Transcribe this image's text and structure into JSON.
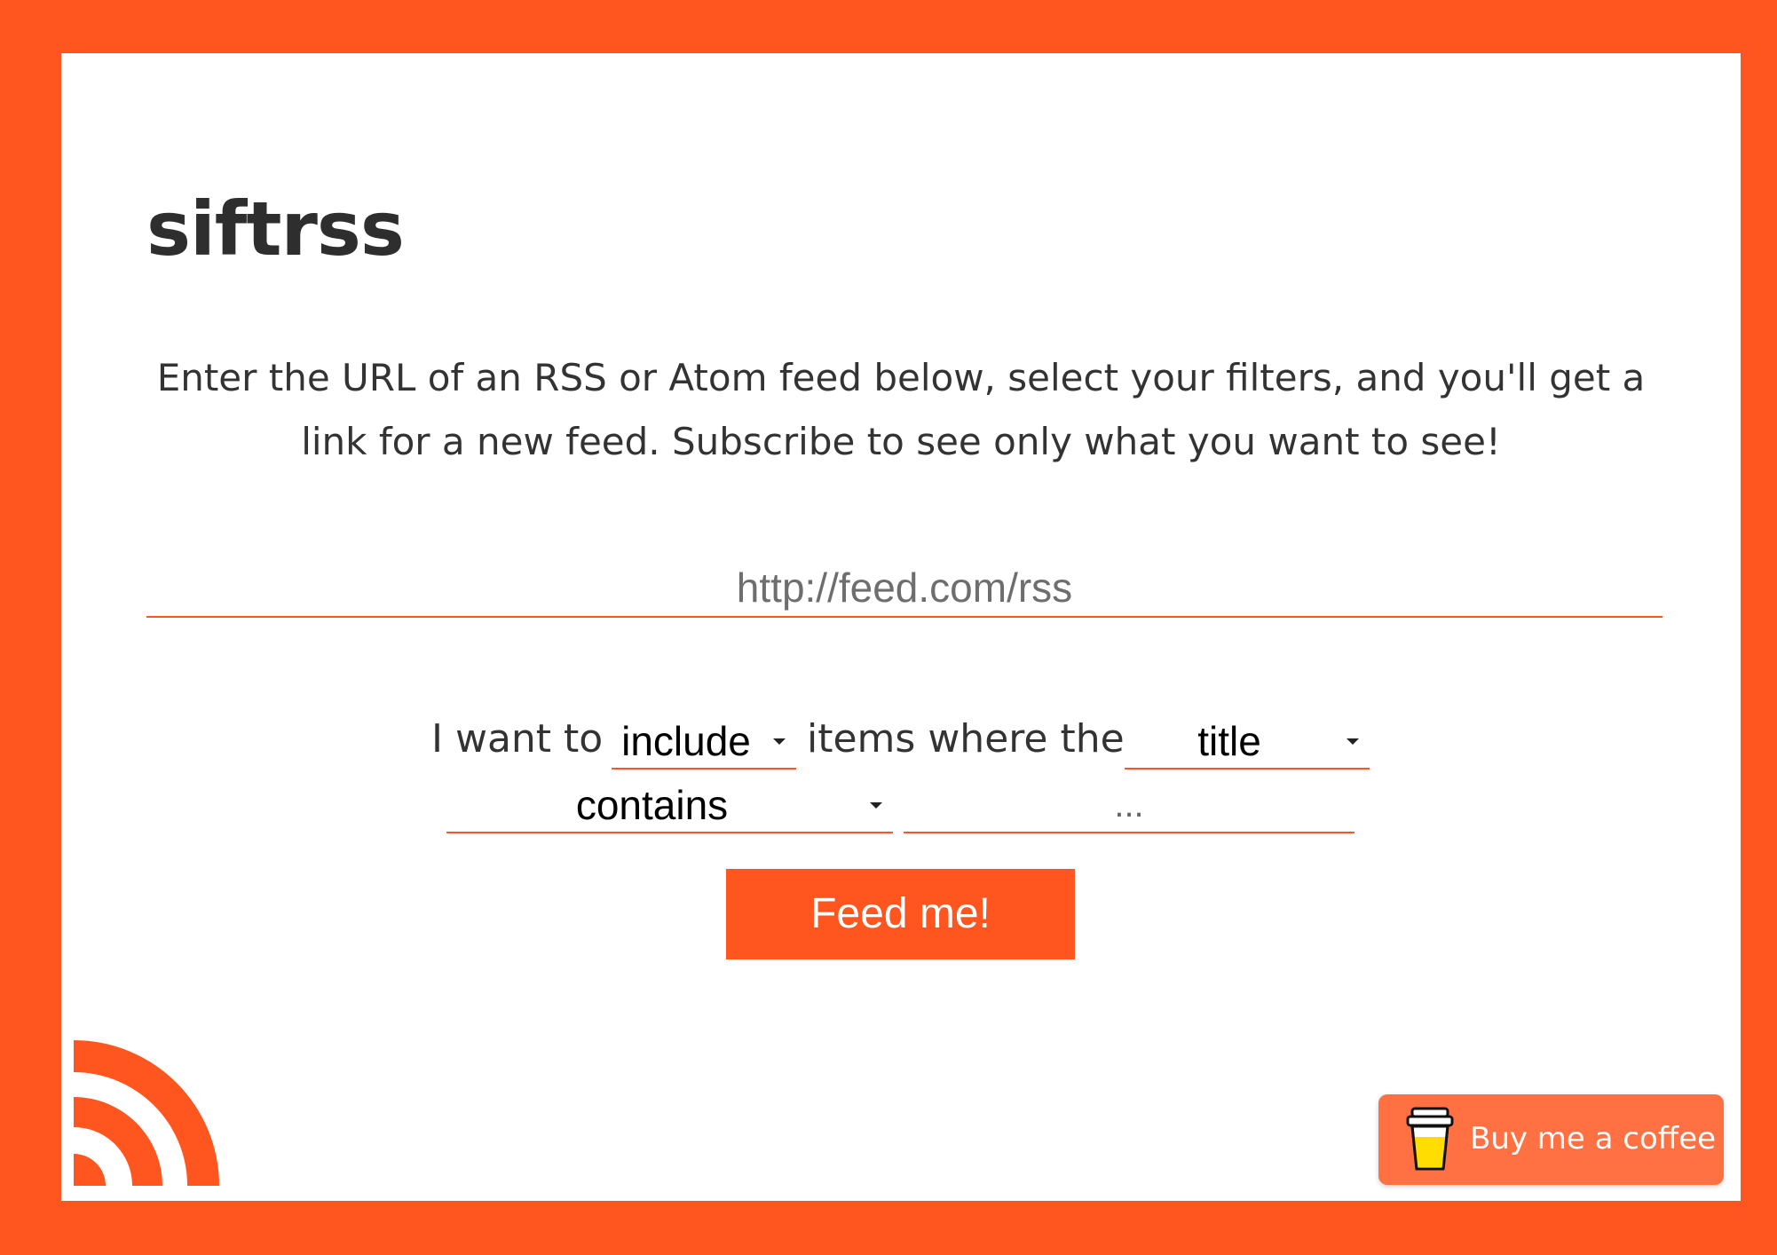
{
  "app": {
    "title": "siftrss",
    "intro": "Enter the URL of an RSS or Atom feed below, select your filters, and you'll get a link for a new feed. Subscribe to see only what you want to see!"
  },
  "feed_url": {
    "placeholder": "http://feed.com/rss",
    "value": ""
  },
  "filter": {
    "prefix": "I want to",
    "middle": "items where the",
    "action_selected": "include",
    "field_selected": "title",
    "condition_selected": "contains",
    "keyword_placeholder": "...",
    "keyword_value": ""
  },
  "submit_label": "Feed me!",
  "footer": {
    "rss_logo_icon": "rss-feed-icon",
    "coffee_label": "Buy me a coffee",
    "coffee_icon": "coffee-cup-icon"
  },
  "colors": {
    "brand": "#ff5620",
    "coffee_button": "#ff7142",
    "text": "#333333",
    "background": "#ffffff"
  }
}
